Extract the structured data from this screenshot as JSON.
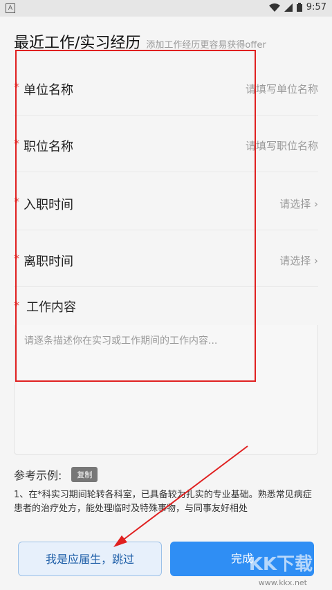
{
  "status_bar": {
    "left_icon": "A",
    "time": "9:57",
    "icons": [
      "wifi-icon",
      "signal-icon",
      "battery-icon"
    ]
  },
  "header": {
    "title": "最近工作/实习经历",
    "subtitle": "添加工作经历更容易获得offer"
  },
  "form": {
    "required_mark": "*",
    "fields": [
      {
        "label": "单位名称",
        "placeholder": "请填写单位名称"
      },
      {
        "label": "职位名称",
        "placeholder": "请填写职位名称"
      },
      {
        "label": "入职时间",
        "placeholder": "请选择 ›"
      },
      {
        "label": "离职时间",
        "placeholder": "请选择 ›"
      },
      {
        "label": "工作内容",
        "placeholder": ""
      }
    ],
    "content_placeholder": "请逐条描述你在实习或工作期间的工作内容..."
  },
  "reference": {
    "label": "参考示例:",
    "copy_label": "复制",
    "text": "1、在*科实习期间轮转各科室，已具备较为扎实的专业基础。熟悉常见病症患者的治疗处方，能处理临时及特殊事物，与同事友好相处"
  },
  "buttons": {
    "skip": "我是应届生，跳过",
    "done": "完成"
  },
  "watermark": {
    "text": "KK下载",
    "url": "www.kkx.net"
  },
  "colors": {
    "accent": "#2f8ef4",
    "required": "#e53935",
    "annotation": "#e02020"
  }
}
